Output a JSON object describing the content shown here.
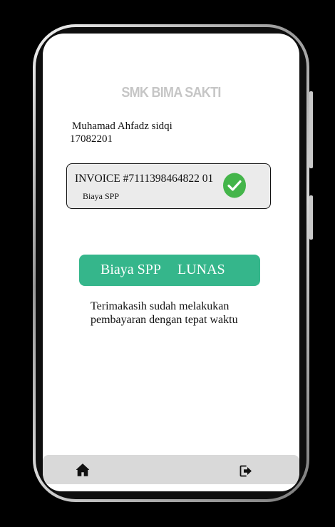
{
  "app": {
    "school_name": "SMK BIMA SAKTI"
  },
  "student": {
    "name": "Muhamad Ahfadz sidqi",
    "id": "17082201"
  },
  "invoice": {
    "number": "INVOICE #7111398464822 01",
    "description": "Biaya SPP",
    "status_icon": "check-circle-icon"
  },
  "status_banner": {
    "label": "Biaya SPP",
    "status": "LUNAS"
  },
  "message": {
    "line1": "Terimakasih sudah melakukan",
    "line2": "pembayaran dengan tepat waktu"
  },
  "bottom_nav": {
    "items": [
      {
        "icon": "home-icon"
      },
      {
        "icon": "logout-icon"
      }
    ]
  },
  "colors": {
    "accent": "#35b68b",
    "check_bg": "#44b54a",
    "card_bg": "#ebebeb",
    "nav_bg": "#d9d9d9",
    "title": "#c6c6c6"
  }
}
